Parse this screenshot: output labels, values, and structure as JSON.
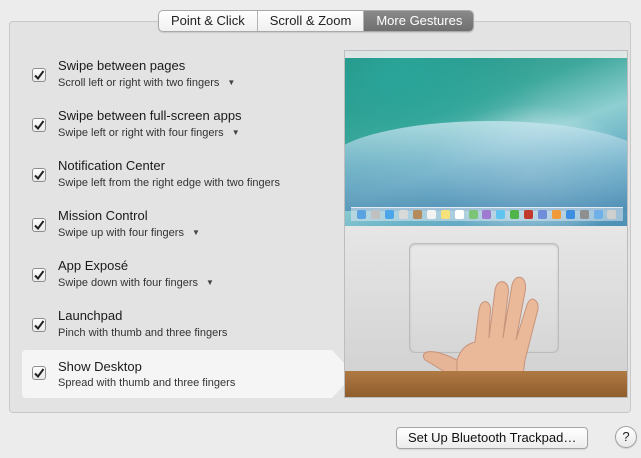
{
  "tabs": [
    {
      "label": "Point & Click",
      "active": false
    },
    {
      "label": "Scroll & Zoom",
      "active": false
    },
    {
      "label": "More Gestures",
      "active": true
    }
  ],
  "gestures": [
    {
      "title": "Swipe between pages",
      "description": "Scroll left or right with two fingers",
      "checked": true,
      "has_dropdown": true,
      "selected": false
    },
    {
      "title": "Swipe between full-screen apps",
      "description": "Swipe left or right with four fingers",
      "checked": true,
      "has_dropdown": true,
      "selected": false
    },
    {
      "title": "Notification Center",
      "description": "Swipe left from the right edge with two fingers",
      "checked": true,
      "has_dropdown": false,
      "selected": false
    },
    {
      "title": "Mission Control",
      "description": "Swipe up with four fingers",
      "checked": true,
      "has_dropdown": true,
      "selected": false
    },
    {
      "title": "App Exposé",
      "description": "Swipe down with four fingers",
      "checked": true,
      "has_dropdown": true,
      "selected": false
    },
    {
      "title": "Launchpad",
      "description": "Pinch with thumb and three fingers",
      "checked": true,
      "has_dropdown": false,
      "selected": false
    },
    {
      "title": "Show Desktop",
      "description": "Spread with thumb and three fingers",
      "checked": true,
      "has_dropdown": false,
      "selected": true
    }
  ],
  "icons": {
    "checkbox_check": "checkmark-icon",
    "dropdown": "chevron-down-icon"
  },
  "footer": {
    "bluetooth_button": "Set Up Bluetooth Trackpad…",
    "help_button": "?"
  },
  "colors": {
    "active_tab": "#7b7b7b",
    "panel_bg": "#e3e3e3",
    "selected_row": "#f5f5f5"
  }
}
